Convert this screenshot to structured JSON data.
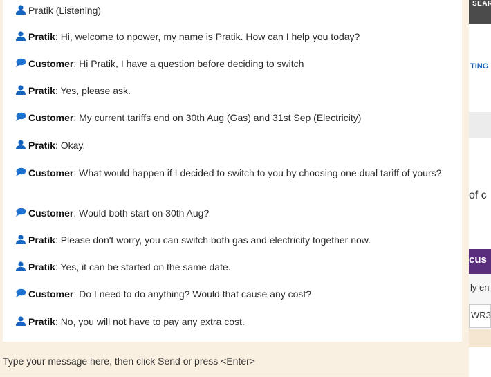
{
  "chat": {
    "status_line": {
      "icon": "agent-person-icon",
      "text": "Pratik (Listening)"
    },
    "messages": [
      {
        "sender_type": "agent",
        "icon": "agent-person-icon",
        "sender": "Pratik",
        "text": ": Hi, welcome to npower, my name is Pratik.  How can I help you today?"
      },
      {
        "sender_type": "customer",
        "icon": "speech-bubble-icon",
        "sender": "Customer",
        "text": ": Hi Pratik, I have a question before deciding to switch"
      },
      {
        "sender_type": "agent",
        "icon": "agent-person-icon",
        "sender": "Pratik",
        "text": ": Yes, please ask."
      },
      {
        "sender_type": "customer",
        "icon": "speech-bubble-icon",
        "sender": "Customer",
        "text": ": My current tariffs end on 30th Aug (Gas) and 31st Sep (Electricity)"
      },
      {
        "sender_type": "agent",
        "icon": "agent-person-icon",
        "sender": "Pratik",
        "text": ": Okay."
      },
      {
        "sender_type": "customer",
        "icon": "speech-bubble-icon",
        "sender": "Customer",
        "text": ": What would happen if I decided to switch to you by choosing one dual tariff of yours?"
      },
      {
        "sender_type": "customer",
        "icon": "speech-bubble-icon",
        "sender": "Customer",
        "text": ": Would both start on 30th Aug?"
      },
      {
        "sender_type": "agent",
        "icon": "agent-person-icon",
        "sender": "Pratik",
        "text": ": Please don't worry, you can switch both gas and electricity together now."
      },
      {
        "sender_type": "agent",
        "icon": "agent-person-icon",
        "sender": "Pratik",
        "text": ": Yes, it can be started on the same date."
      },
      {
        "sender_type": "customer",
        "icon": "speech-bubble-icon",
        "sender": "Customer",
        "text": ": Do I need to do anything? Would that cause any cost?"
      },
      {
        "sender_type": "agent",
        "icon": "agent-person-icon",
        "sender": "Pratik",
        "text": ": No, you will not have to pay any extra cost."
      }
    ],
    "composer": {
      "placeholder": "Type your message here, then click Send or press <Enter>"
    }
  },
  "background_page": {
    "search_label": "SEAR",
    "nav_fragment": "TING",
    "heading_fragment": "of c",
    "banner_fragment": "cus",
    "subtext_fragment": "ly en",
    "field_value_fragment": "WR3"
  },
  "colors": {
    "agent_icon": "#1565c0",
    "customer_icon": "#1e73d2",
    "chat_frame": "#faf0e1",
    "banner_purple": "#5b2d7d",
    "nav_blue": "#1a63b0"
  }
}
